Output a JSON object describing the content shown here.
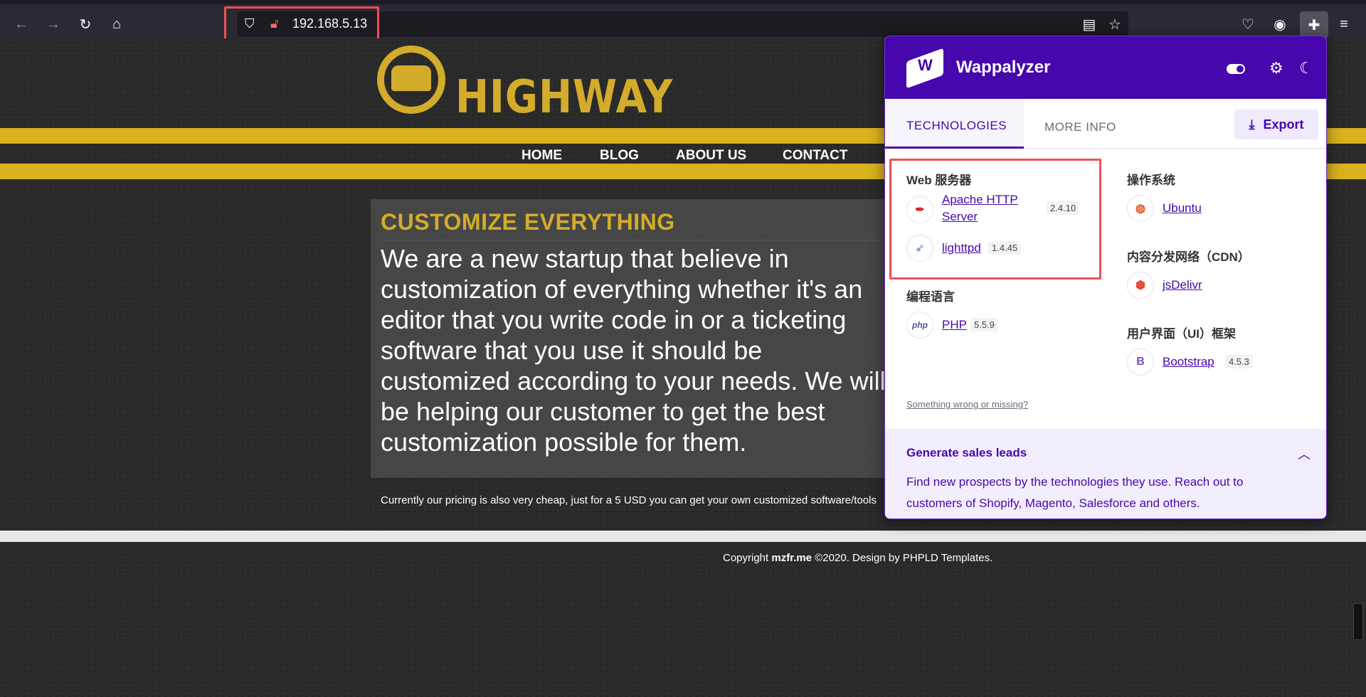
{
  "browser": {
    "url": "192.168.5.13"
  },
  "site": {
    "logo_text": "HIGHWAY",
    "nav": [
      "HOME",
      "BLOG",
      "ABOUT US",
      "CONTACT"
    ],
    "content_title": "CUSTOMIZE EVERYTHING",
    "content_body": "We are a new startup that believe in customization of everything whether it's an editor that you write code in or a ticketing software that you use it should be customized according to your needs. We will be helping our customer to get the best customization possible for them.",
    "content_small": "Currently our pricing is also very cheap, just for a 5 USD you can get your own customized software/tools",
    "copyright_prefix": "Copyright ",
    "copyright_site": "mzfr.me",
    "copyright_suffix": " ©2020. Design by PHPLD Templates."
  },
  "wappalyzer": {
    "brand": "Wappalyzer",
    "tabs": {
      "technologies": "TECHNOLOGIES",
      "more_info": "MORE INFO"
    },
    "export_label": "Export",
    "categories": {
      "web_server": "Web 服务器",
      "programming": "编程语言",
      "os": "操作系统",
      "cdn": "内容分发网络（CDN）",
      "ui": "用户界面（UI）框架"
    },
    "techs": {
      "apache": {
        "name": "Apache HTTP Server",
        "version": "2.4.10"
      },
      "lighttpd": {
        "name": "lighttpd",
        "version": "1.4.45"
      },
      "php": {
        "name": "PHP",
        "version": "5.5.9"
      },
      "ubuntu": {
        "name": "Ubuntu"
      },
      "jsdelivr": {
        "name": "jsDelivr"
      },
      "bootstrap": {
        "name": "Bootstrap",
        "version": "4.5.3"
      }
    },
    "missing_link": "Something wrong or missing?",
    "leads": {
      "title": "Generate sales leads",
      "body": "Find new prospects by the technologies they use. Reach out to customers of Shopify, Magento, Salesforce and others."
    }
  },
  "colors": {
    "wappalyzer_purple": "#4608ad",
    "highway_yellow": "#d4ac2b",
    "highlight_red": "#ef4f58"
  }
}
